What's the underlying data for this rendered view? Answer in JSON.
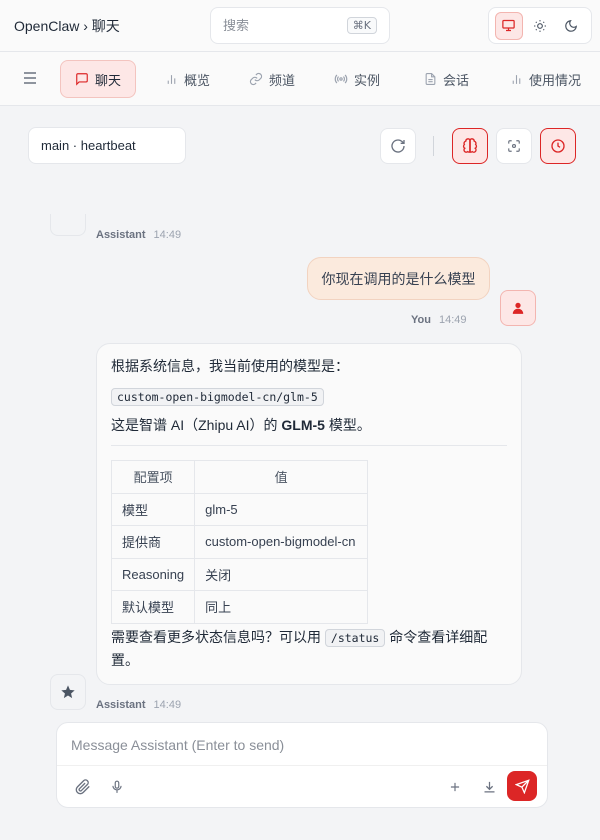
{
  "header": {
    "breadcrumb": "OpenClaw › 聊天",
    "search_placeholder": "搜索",
    "search_shortcut": "⌘K",
    "theme_options": [
      "system-icon",
      "sun-icon",
      "moon-icon"
    ]
  },
  "nav": {
    "items": [
      {
        "label": "聊天",
        "icon": "chat-icon",
        "active": true
      },
      {
        "label": "概览",
        "icon": "bar-chart-icon"
      },
      {
        "label": "频道",
        "icon": "link-icon"
      },
      {
        "label": "实例",
        "icon": "radio-icon"
      },
      {
        "label": "会话",
        "icon": "document-icon"
      },
      {
        "label": "使用情况",
        "icon": "bar-chart-icon"
      }
    ]
  },
  "toolbar": {
    "session": "main · heartbeat"
  },
  "messages": {
    "top_meta": {
      "who": "Assistant",
      "time": "14:49"
    },
    "user": {
      "text": "你现在调用的是什么模型",
      "who": "You",
      "time": "14:49"
    },
    "assistant": {
      "intro": "根据系统信息，我当前使用的模型是：",
      "model_code": "custom-open-bigmodel-cn/glm-5",
      "line2_prefix": "这是智谱 AI（Zhipu AI）的 ",
      "line2_bold": "GLM-5",
      "line2_suffix": " 模型。",
      "table": {
        "headers": [
          "配置项",
          "值"
        ],
        "rows": [
          [
            "模型",
            "glm-5"
          ],
          [
            "提供商",
            "custom-open-bigmodel-cn"
          ],
          [
            "Reasoning",
            "关闭"
          ],
          [
            "默认模型",
            "同上"
          ]
        ]
      },
      "outro_prefix": "需要查看更多状态信息吗？可以用 ",
      "outro_code": "/status",
      "outro_suffix": " 命令查看详细配置。",
      "who": "Assistant",
      "time": "14:49"
    }
  },
  "composer": {
    "placeholder": "Message Assistant (Enter to send)"
  },
  "colors": {
    "accent": "#dc2626",
    "accent_bg": "#fde7e6",
    "user_bubble": "#fbeadd"
  }
}
